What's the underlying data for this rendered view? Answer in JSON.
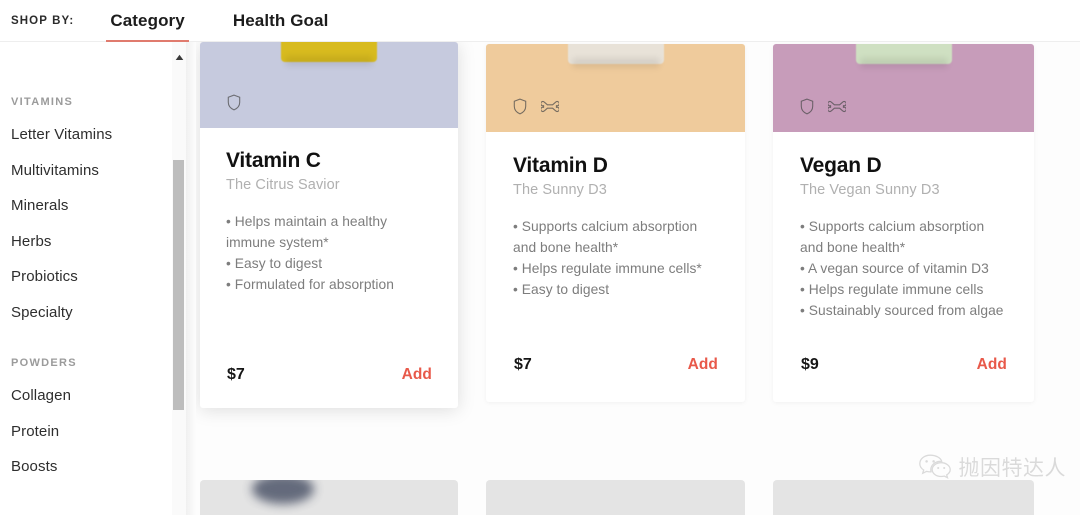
{
  "topbar": {
    "shop_by_label": "SHOP BY:",
    "tabs": [
      {
        "label": "Category",
        "active": true
      },
      {
        "label": "Health Goal",
        "active": false
      }
    ],
    "active_underline_color": "#e07b6e"
  },
  "sidebar": {
    "groups": [
      {
        "title": "VITAMINS",
        "items": [
          {
            "label": "Letter Vitamins"
          },
          {
            "label": "Multivitamins"
          },
          {
            "label": "Minerals"
          },
          {
            "label": "Herbs"
          },
          {
            "label": "Probiotics"
          },
          {
            "label": "Specialty"
          }
        ]
      },
      {
        "title": "POWDERS",
        "items": [
          {
            "label": "Collagen"
          },
          {
            "label": "Protein"
          },
          {
            "label": "Boosts"
          }
        ]
      }
    ],
    "scrollbar": {
      "arrow_icon": "chevron-up-icon",
      "thumb_color": "#bdbdbd"
    }
  },
  "products": [
    {
      "title": "Vitamin C",
      "subtitle": "The Citrus Savior",
      "bullets": [
        "Helps maintain a healthy immune system*",
        "Easy to digest",
        "Formulated for absorption"
      ],
      "price": "$7",
      "add_label": "Add",
      "hero_color": "#c6cade",
      "bottle_color": "#d8bb1f",
      "badges": [
        "shield-icon"
      ]
    },
    {
      "title": "Vitamin D",
      "subtitle": "The Sunny D3",
      "bullets": [
        "Supports calcium absorption and bone health*",
        "Helps regulate immune cells*",
        "Easy to digest"
      ],
      "price": "$7",
      "add_label": "Add",
      "hero_color": "#efcb9c",
      "bottle_color": "#e8e2d8",
      "badges": [
        "shield-icon",
        "bone-icon"
      ]
    },
    {
      "title": "Vegan D",
      "subtitle": "The Vegan Sunny D3",
      "bullets": [
        "Supports calcium absorption and bone health*",
        "A vegan source of vitamin D3",
        "Helps regulate immune cells",
        "Sustainably sourced from algae"
      ],
      "price": "$9",
      "add_label": "Add",
      "hero_color": "#c79cba",
      "bottle_color": "#cfe0c2",
      "badges": [
        "shield-icon",
        "bone-icon"
      ]
    }
  ],
  "colors": {
    "accent": "#e8594a",
    "tab_underline": "#e07b6e",
    "page_background": "#fdfdfd",
    "muted_text": "#7d7d7d"
  },
  "watermark": {
    "text": "抛因特达人",
    "logo_icon": "wechat-icon"
  }
}
